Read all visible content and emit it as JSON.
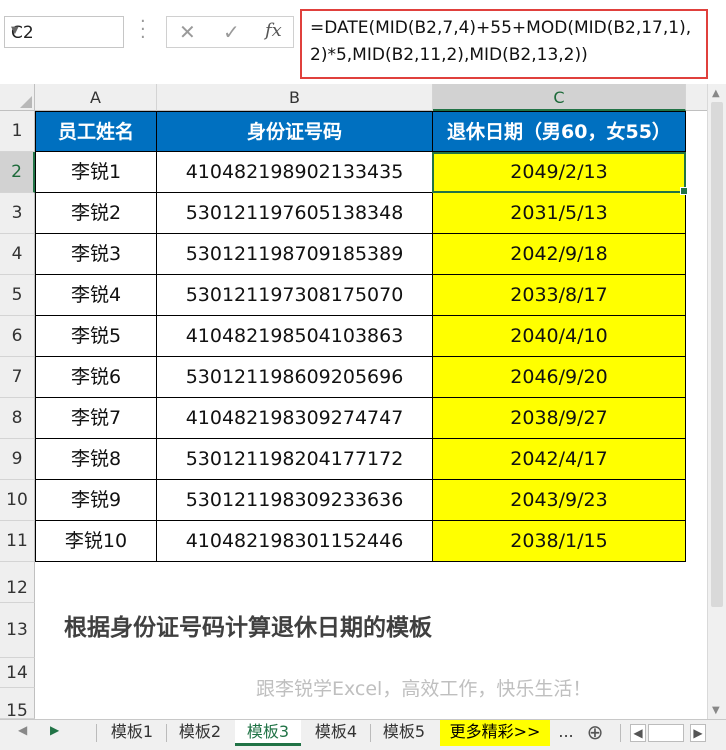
{
  "name_box": {
    "value": "C2"
  },
  "formula_bar": {
    "cancel_glyph": "✕",
    "enter_glyph": "✓",
    "fx_glyph": "fx",
    "formula": "=DATE(MID(B2,7,4)+55+MOD(MID(B2,17,1),2)*5,MID(B2,11,2),MID(B2,13,2))"
  },
  "columns": [
    "A",
    "B",
    "C"
  ],
  "row_numbers": [
    "1",
    "2",
    "3",
    "4",
    "5",
    "6",
    "7",
    "8",
    "9",
    "10",
    "11",
    "12",
    "13",
    "14",
    "15"
  ],
  "table": {
    "headers": [
      "员工姓名",
      "身份证号码",
      "退休日期（男60，女55）"
    ],
    "rows": [
      {
        "name": "李锐1",
        "id": "410482198902133435",
        "date": "2049/2/13"
      },
      {
        "name": "李锐2",
        "id": "530121197605138348",
        "date": "2031/5/13"
      },
      {
        "name": "李锐3",
        "id": "530121198709185389",
        "date": "2042/9/18"
      },
      {
        "name": "李锐4",
        "id": "530121197308175070",
        "date": "2033/8/17"
      },
      {
        "name": "李锐5",
        "id": "410482198504103863",
        "date": "2040/4/10"
      },
      {
        "name": "李锐6",
        "id": "530121198609205696",
        "date": "2046/9/20"
      },
      {
        "name": "李锐7",
        "id": "410482198309274747",
        "date": "2038/9/27"
      },
      {
        "name": "李锐8",
        "id": "530121198204177172",
        "date": "2042/4/17"
      },
      {
        "name": "李锐9",
        "id": "530121198309233636",
        "date": "2043/9/23"
      },
      {
        "name": "李锐10",
        "id": "410482198301152446",
        "date": "2038/1/15"
      }
    ]
  },
  "notes": {
    "title": "根据身份证号码计算退休日期的模板",
    "subtitle": "跟李锐学Excel，高效工作，快乐生活！"
  },
  "sheet_tabs": [
    "模板1",
    "模板2",
    "模板3",
    "模板4",
    "模板5",
    "更多精彩>>"
  ],
  "active_tab": "模板3",
  "tab_overflow": "...",
  "add_sheet_glyph": "⊕",
  "colors": {
    "header_bg": "#0070c0",
    "result_bg": "#ffff00",
    "highlight_border": "#e0403c",
    "excel_green": "#217346"
  }
}
